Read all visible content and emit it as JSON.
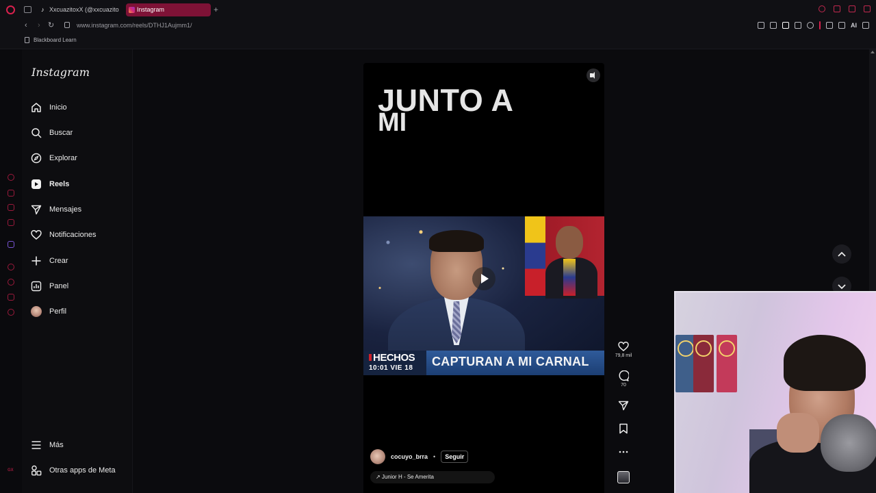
{
  "browser": {
    "tabs": [
      {
        "title": "XxcuazitoxX (@xxcuazitox",
        "active": false
      },
      {
        "title": "Instagram",
        "active": true
      }
    ],
    "new_tab": "+",
    "url": "www.instagram.com/reels/DTHJ1Aujmm1/",
    "ai_label": "AI",
    "bookmarks": [
      {
        "label": "Blackboard Learn"
      }
    ],
    "accent_color": "#d9214e"
  },
  "sidebar": {
    "logo": "Instagram",
    "items": [
      {
        "label": "Inicio",
        "icon": "home-icon"
      },
      {
        "label": "Buscar",
        "icon": "search-icon"
      },
      {
        "label": "Explorar",
        "icon": "compass-icon"
      },
      {
        "label": "Reels",
        "icon": "reels-icon",
        "active": true
      },
      {
        "label": "Mensajes",
        "icon": "send-icon"
      },
      {
        "label": "Notificaciones",
        "icon": "heart-icon"
      },
      {
        "label": "Crear",
        "icon": "plus-icon"
      },
      {
        "label": "Panel",
        "icon": "chart-icon"
      },
      {
        "label": "Perfil",
        "icon": "avatar"
      }
    ],
    "bottom_items": [
      {
        "label": "Más",
        "icon": "menu-icon"
      },
      {
        "label": "Otras apps de Meta",
        "icon": "apps-icon"
      }
    ]
  },
  "reel": {
    "title_line1": "JUNTO A",
    "title_line2": "MI",
    "news": {
      "brand": "HECHOS",
      "time": "10:01  VIE  18",
      "headline": "CAPTURAN A MI CARNAL"
    },
    "author": "cocuyo_brra",
    "separator": "•",
    "follow_label": "Seguir",
    "audio": "↗ Junior H - Se Amerita",
    "likes": "79,8 mil",
    "comments": "70"
  },
  "rail_label": "GX"
}
